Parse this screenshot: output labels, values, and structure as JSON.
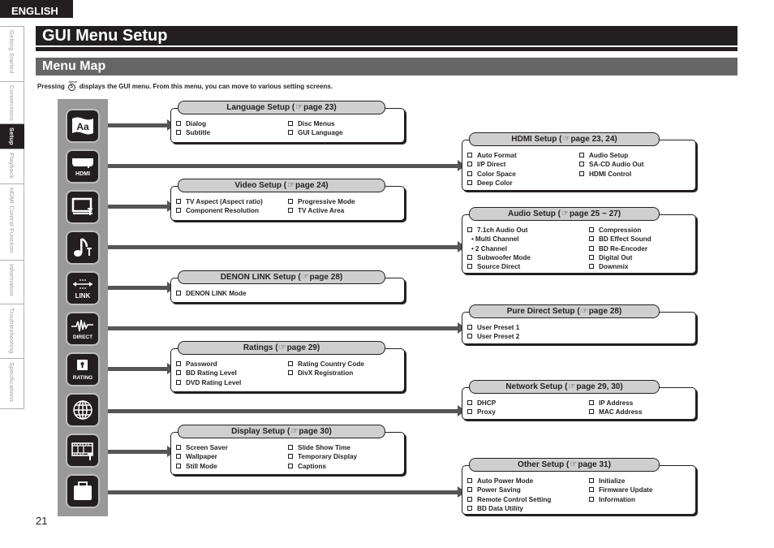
{
  "header": {
    "language_tab": "ENGLISH",
    "title": "GUI Menu Setup",
    "subtitle": "Menu Map",
    "intro_before": "Pressing",
    "intro_button_label": "SETUP",
    "intro_button_number": "5",
    "intro_after": "displays the GUI menu. From this menu, you can move to various setting screens."
  },
  "side_tabs": [
    {
      "label": "Getting Started",
      "active": false
    },
    {
      "label": "Connections",
      "active": false
    },
    {
      "label": "Setup",
      "active": true
    },
    {
      "label": "Playback",
      "active": false
    },
    {
      "label": "HDMI Control Function",
      "active": false
    },
    {
      "label": "Information",
      "active": false
    },
    {
      "label": "Troubleshooting",
      "active": false
    },
    {
      "label": "Specifications",
      "active": false
    }
  ],
  "icons": [
    {
      "name": "language-icon",
      "text": "Aa"
    },
    {
      "name": "hdmi-icon",
      "text": "HDMI"
    },
    {
      "name": "video-icon",
      "text": ""
    },
    {
      "name": "audio-icon",
      "text": ""
    },
    {
      "name": "denon-link-icon",
      "text": "LINK"
    },
    {
      "name": "pure-direct-icon",
      "text": "DIRECT"
    },
    {
      "name": "rating-icon",
      "text": "RATING"
    },
    {
      "name": "network-icon",
      "text": ""
    },
    {
      "name": "display-icon",
      "text": ""
    },
    {
      "name": "other-icon",
      "text": ""
    }
  ],
  "hand_glyph": "☞",
  "boxes": {
    "language": {
      "title": "Language Setup (",
      "page": "page 23)",
      "col1": [
        "Dialog",
        "Subtitle"
      ],
      "col2": [
        "Disc Menus",
        "GUI Language"
      ]
    },
    "hdmi": {
      "title": "HDMI Setup (",
      "page": "page 23, 24)",
      "col1": [
        "Auto Format",
        "I/P Direct",
        "Color Space",
        "Deep Color"
      ],
      "col2": [
        "Audio Setup",
        "SA-CD Audio Out",
        "HDMI Control"
      ]
    },
    "video": {
      "title": "Video Setup (",
      "page": "page 24)",
      "col1": [
        "TV Aspect (Aspect ratio)",
        "Component Resolution"
      ],
      "col2": [
        "Progressive Mode",
        "TV Active Area"
      ]
    },
    "audio": {
      "title": "Audio Setup (",
      "page": "page 25 ~ 27)",
      "col1_main": "7.1ch Audio Out",
      "col1_subs": [
        "Multi Channel",
        "2 Channel"
      ],
      "col1_rest": [
        "Subwoofer Mode",
        "Source Direct"
      ],
      "col2": [
        "Compression",
        "BD Effect Sound",
        "BD Re-Encoder",
        "Digital Out",
        "Downmix"
      ]
    },
    "denon_link": {
      "title": "DENON LINK Setup (",
      "page": "page 28)",
      "col1": [
        "DENON LINK Mode"
      ]
    },
    "pure_direct": {
      "title": "Pure Direct Setup (",
      "page": "page 28)",
      "col1": [
        "User Preset 1",
        "User Preset 2"
      ]
    },
    "ratings": {
      "title": "Ratings (",
      "page": "page 29)",
      "col1": [
        "Password",
        "BD Rating Level",
        "DVD Rating Level"
      ],
      "col2": [
        "Rating Country Code",
        "DivX Registration"
      ]
    },
    "network": {
      "title": "Network Setup (",
      "page": "page 29, 30)",
      "col1": [
        "DHCP",
        "Proxy"
      ],
      "col2": [
        "IP Address",
        "MAC Address"
      ]
    },
    "display": {
      "title": "Display Setup (",
      "page": "page 30)",
      "col1": [
        "Screen Saver",
        "Wallpaper",
        "Still Mode"
      ],
      "col2": [
        "Slide Show Time",
        "Temporary Display",
        "Captions"
      ]
    },
    "other": {
      "title": "Other Setup (",
      "page": "page 31)",
      "col1": [
        "Auto Power Mode",
        "Power Saving",
        "Remote Control Setting",
        "BD Data Utility"
      ],
      "col2": [
        "Initialize",
        "Firmware Update",
        "Information"
      ]
    }
  },
  "page_number": "21"
}
